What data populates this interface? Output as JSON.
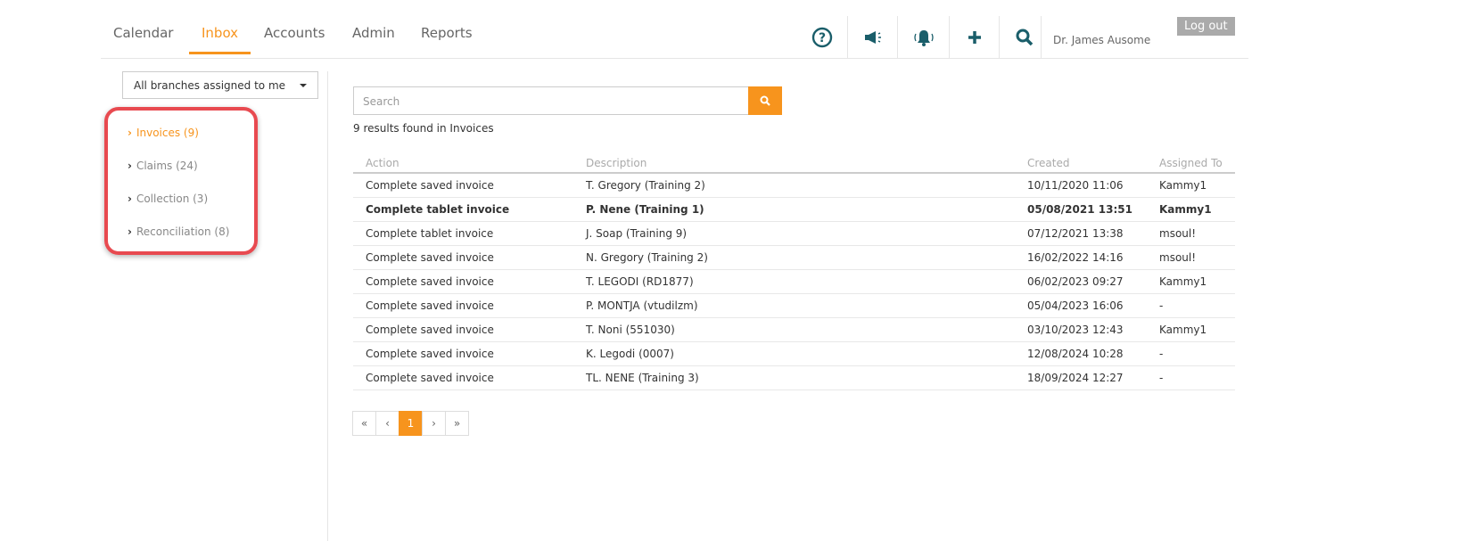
{
  "nav": {
    "tabs": [
      "Calendar",
      "Inbox",
      "Accounts",
      "Admin",
      "Reports"
    ],
    "active": "Inbox"
  },
  "header": {
    "user": "Dr. James Ausome",
    "logout": "Log out"
  },
  "sidebar": {
    "branch_select": "All branches assigned to me",
    "folders": [
      {
        "label": "Invoices (9)"
      },
      {
        "label": "Claims (24)"
      },
      {
        "label": "Collection (3)"
      },
      {
        "label": "Reconciliation (8)"
      }
    ]
  },
  "search": {
    "placeholder": "Search",
    "results": "9 results found in Invoices"
  },
  "table": {
    "headers": [
      "Action",
      "Description",
      "Created",
      "Assigned To"
    ],
    "rows": [
      [
        "Complete saved invoice",
        "T. Gregory (Training 2)",
        "10/11/2020 11:06",
        "Kammy1"
      ],
      [
        "Complete tablet invoice",
        "P. Nene (Training 1)",
        "05/08/2021 13:51",
        "Kammy1"
      ],
      [
        "Complete tablet invoice",
        "J. Soap (Training 9)",
        "07/12/2021 13:38",
        "msoul!"
      ],
      [
        "Complete saved invoice",
        "N. Gregory (Training 2)",
        "16/02/2022 14:16",
        "msoul!"
      ],
      [
        "Complete saved invoice",
        "T. LEGODI (RD1877)",
        "06/02/2023 09:27",
        "Kammy1"
      ],
      [
        "Complete saved invoice",
        "P. MONTJA (vtudilzm)",
        "05/04/2023 16:06",
        "-"
      ],
      [
        "Complete saved invoice",
        "T. Noni (551030)",
        "03/10/2023 12:43",
        "Kammy1"
      ],
      [
        "Complete saved invoice",
        "K. Legodi (0007)",
        "12/08/2024 10:28",
        "-"
      ],
      [
        "Complete saved invoice",
        "TL. NENE (Training 3)",
        "18/09/2024 12:27",
        "-"
      ]
    ]
  },
  "pager": {
    "first": "«",
    "prev": "‹",
    "current": "1",
    "next": "›",
    "last": "»"
  }
}
